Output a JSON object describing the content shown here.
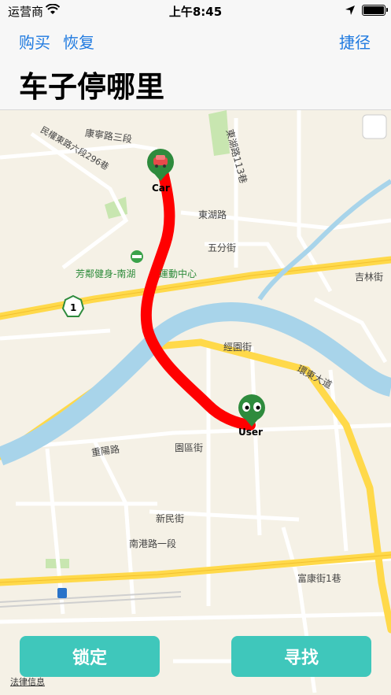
{
  "status_bar": {
    "carrier": "运营商",
    "time": "上午8:45"
  },
  "navbar": {
    "buy_label": "购买",
    "restore_label": "恢复",
    "shortcut_label": "捷径",
    "title": "车子停哪里"
  },
  "map": {
    "labels": {
      "kangning": "康寧路三段",
      "minquan": "民權東路六段296巷",
      "donghu": "東湖路",
      "donghu113": "東湖路113巷",
      "wufen": "五分街",
      "fitness": "芳鄰健身-南湖",
      "sports_center": "運動中心",
      "jilin": "吉林街",
      "jinyuan": "經園街",
      "huandong": "環東大道",
      "chongyang": "重陽路",
      "yuanqu": "園區街",
      "xinmin": "新民街",
      "nangang": "南港路一段",
      "fukang": "富康街1巷",
      "road_one": "1"
    },
    "car_pin_label": "Car",
    "user_pin_label": "User",
    "route_color": "#ff0000",
    "car_pin_color": "#2e8b3d",
    "user_pin_color": "#2e8b3d"
  },
  "actions": {
    "lock_label": "锁定",
    "find_label": "寻找"
  },
  "legal_label": "法律信息"
}
